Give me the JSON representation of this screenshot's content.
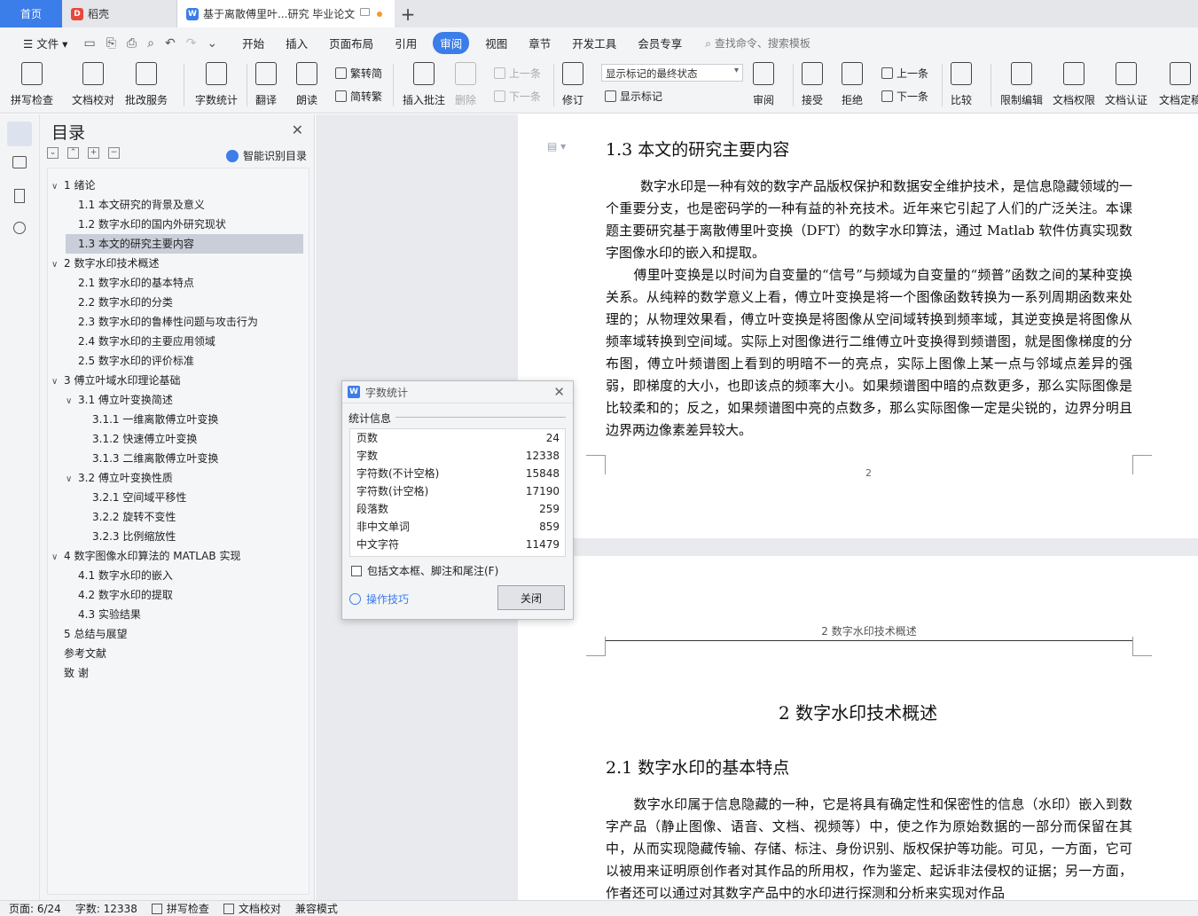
{
  "tabs": {
    "home": "首页",
    "daoke": "稻壳",
    "doc": "基于离散傅里叶...研究 毕业论文",
    "add": "+"
  },
  "menubar": {
    "file": "文件",
    "items": [
      "开始",
      "插入",
      "页面布局",
      "引用",
      "审阅",
      "视图",
      "章节",
      "开发工具",
      "会员专享"
    ],
    "search": "查找命令、搜索模板"
  },
  "ribbon": {
    "spell": "拼写检查",
    "doccheck": "文档校对",
    "correct": "批改服务",
    "wordcount": "字数统计",
    "translate": "翻译",
    "read": "朗读",
    "trad": "繁转简",
    "simp": "简转繁",
    "insert_comment": "插入批注",
    "delete": "删除",
    "prev": "上一条",
    "next": "下一条",
    "revise": "修订",
    "markup_state": "显示标记的最终状态",
    "show_markup": "显示标记",
    "review": "审阅",
    "accept": "接受",
    "reject": "拒绝",
    "prev2": "上一条",
    "next2": "下一条",
    "compare": "比较",
    "restrict": "限制编辑",
    "permission": "文档权限",
    "certify": "文档认证",
    "finalize": "文档定稿"
  },
  "toc": {
    "title": "目录",
    "smart": "智能识别目录",
    "items": [
      {
        "text": "1    绪论",
        "arrow": "∨"
      },
      {
        "text": "1.1    本文研究的背景及意义",
        "arrow": ""
      },
      {
        "text": "1.2    数字水印的国内外研究现状",
        "arrow": ""
      },
      {
        "text": "1.3    本文的研究主要内容",
        "arrow": ""
      },
      {
        "text": "2    数字水印技术概述",
        "arrow": "∨"
      },
      {
        "text": "2.1    数字水印的基本特点",
        "arrow": ""
      },
      {
        "text": "2.2    数字水印的分类",
        "arrow": ""
      },
      {
        "text": "2.3    数字水印的鲁棒性问题与攻击行为",
        "arrow": ""
      },
      {
        "text": "2.4    数字水印的主要应用领域",
        "arrow": ""
      },
      {
        "text": "2.5    数字水印的评价标准",
        "arrow": ""
      },
      {
        "text": "3    傅立叶域水印理论基础",
        "arrow": "∨"
      },
      {
        "text": "3.1    傅立叶变换简述",
        "arrow": "∨"
      },
      {
        "text": "3.1.1    一维离散傅立叶变换",
        "arrow": ""
      },
      {
        "text": "3.1.2    快速傅立叶变换",
        "arrow": ""
      },
      {
        "text": "3.1.3    二维离散傅立叶变换",
        "arrow": ""
      },
      {
        "text": "3.2    傅立叶变换性质",
        "arrow": "∨"
      },
      {
        "text": "3.2.1    空间域平移性",
        "arrow": ""
      },
      {
        "text": "3.2.2    旋转不变性",
        "arrow": ""
      },
      {
        "text": "3.2.3    比例缩放性",
        "arrow": ""
      },
      {
        "text": "4    数字图像水印算法的 MATLAB  实现",
        "arrow": "∨"
      },
      {
        "text": "4.1 数字水印的嵌入",
        "arrow": ""
      },
      {
        "text": "4.2 数字水印的提取",
        "arrow": ""
      },
      {
        "text": "4.3 实验结果",
        "arrow": ""
      },
      {
        "text": "5    总结与展望",
        "arrow": ""
      },
      {
        "text": "参考文献",
        "arrow": ""
      },
      {
        "text": "致    谢",
        "arrow": ""
      }
    ]
  },
  "document": {
    "h13": "1.3    本文的研究主要内容",
    "p1": "数字水印是一种有效的数字产品版权保护和数据安全维护技术，是信息隐藏领域的一个重要分支，也是密码学的一种有益的补充技术。近年来它引起了人们的广泛关注。本课题主要研究基于离散傅里叶变换（DFT）的数字水印算法，通过 Matlab 软件仿真实现数字图像水印的嵌入和提取。",
    "p2": "傅里叶变换是以时间为自变量的“信号”与频域为自变量的“频普”函数之间的某种变换关系。从纯粹的数学意义上看，傅立叶变换是将一个图像函数转换为一系列周期函数来处理的；从物理效果看，傅立叶变换是将图像从空间域转换到频率域，其逆变换是将图像从频率域转换到空间域。实际上对图像进行二维傅立叶变换得到频谱图，就是图像梯度的分布图，傅立叶频谱图上看到的明暗不一的亮点，实际上图像上某一点与邻域点差异的强弱，即梯度的大小，也即该点的频率大小。如果频谱图中暗的点数更多，那么实际图像是比较柔和的；反之，如果频谱图中亮的点数多，那么实际图像一定是尖锐的，边界分明且边界两边像素差异较大。",
    "page_num": "2",
    "header": "2    数字水印技术概述",
    "h2": "2    数字水印技术概述",
    "h21": "2.1    数字水印的基本特点",
    "p3": "数字水印属于信息隐藏的一种，它是将具有确定性和保密性的信息（水印）嵌入到数字产品（静止图像、语音、文档、视频等）中，使之作为原始数据的一部分而保留在其中，从而实现隐藏传输、存储、标注、身份识别、版权保护等功能。可见，一方面，它可以被用来证明原创作者对其作品的所用权，作为鉴定、起诉非法侵权的证据；另一方面，作者还可以通过对其数字产品中的水印进行探测和分析来实现对作品"
  },
  "dialog": {
    "title": "字数统计",
    "section": "统计信息",
    "stats": [
      {
        "label": "页数",
        "value": "24"
      },
      {
        "label": "字数",
        "value": "12338"
      },
      {
        "label": "字符数(不计空格)",
        "value": "15848"
      },
      {
        "label": "字符数(计空格)",
        "value": "17190"
      },
      {
        "label": "段落数",
        "value": "259"
      },
      {
        "label": "非中文单词",
        "value": "859"
      },
      {
        "label": "中文字符",
        "value": "11479"
      }
    ],
    "checkbox": "包括文本框、脚注和尾注(F)",
    "tips": "操作技巧",
    "close": "关闭"
  },
  "status": {
    "page": "页面: 6/24",
    "words": "字数: 12338",
    "spell": "拼写检查",
    "doccheck": "文档校对",
    "compat": "兼容模式"
  },
  "colors": {
    "accent": "#3b7de9",
    "tabbar": "#e4e6ea",
    "ribbon": "#f3f4f6",
    "docbg": "#e8eaed"
  }
}
